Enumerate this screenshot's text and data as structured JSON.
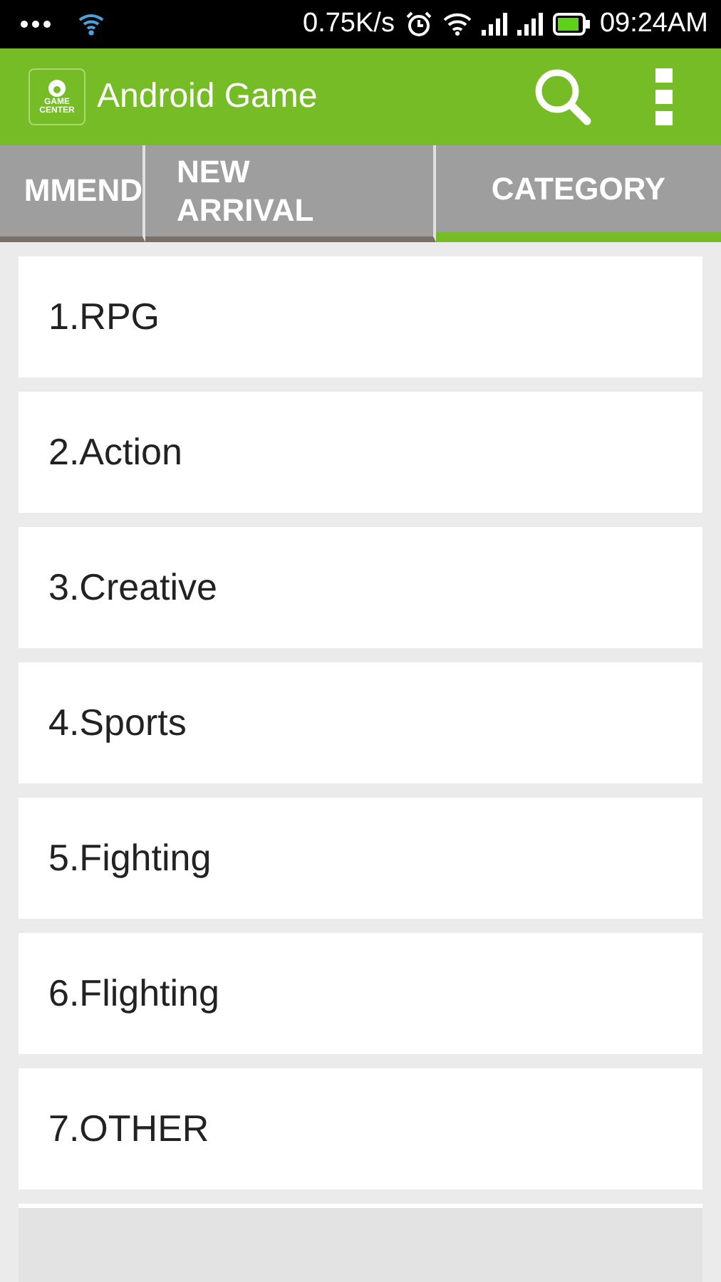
{
  "status_bar": {
    "speed": "0.75K/s",
    "time": "09:24AM"
  },
  "app_bar": {
    "logo": [
      "GAME",
      "CENTER"
    ],
    "title": "Android Game"
  },
  "tabs": [
    {
      "label": "MMEND",
      "selected": false
    },
    {
      "label": "NEW ARRIVAL",
      "selected": false
    },
    {
      "label": "CATEGORY",
      "selected": true
    }
  ],
  "categories": [
    "1.RPG",
    "2.Action",
    "3.Creative",
    "4.Sports",
    "5.Fighting",
    "6.Flighting",
    "7.OTHER"
  ]
}
